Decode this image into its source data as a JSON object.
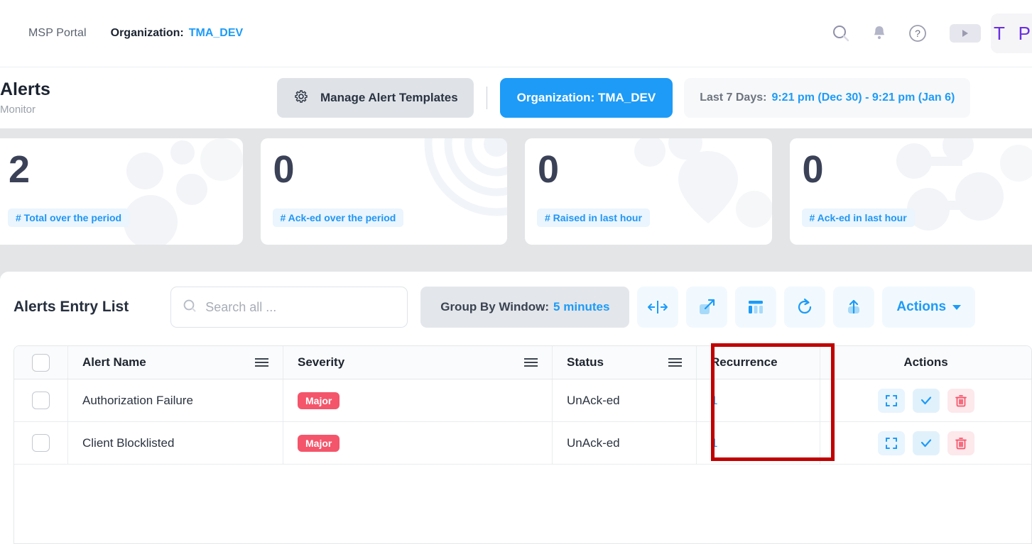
{
  "topbar": {
    "app_name": "MSP Portal",
    "org_label": "Organization:",
    "org_value": "TMA_DEV",
    "icons": [
      "search-icon",
      "bell-icon",
      "help-icon",
      "video-icon"
    ],
    "avatar_initials": "T P"
  },
  "subheader": {
    "title": "Alerts",
    "subtitle": "Monitor",
    "manage_templates": "Manage Alert Templates",
    "organization_button": "Organization: TMA_DEV",
    "range_label": "Last 7 Days:",
    "range_value": "9:21 pm (Dec 30) - 9:21 pm (Jan 6)"
  },
  "cards": [
    {
      "value": "2",
      "label": "# Total over the period",
      "watermark": "circles"
    },
    {
      "value": "0",
      "label": "# Ack-ed over the period",
      "watermark": "arcs"
    },
    {
      "value": "0",
      "label": "# Raised in last hour",
      "watermark": "pin"
    },
    {
      "value": "0",
      "label": "# Ack-ed in last hour",
      "watermark": "molecule"
    }
  ],
  "toolbar": {
    "panel_title": "Alerts Entry List",
    "search_placeholder": "Search all ...",
    "group_label": "Group By Window:",
    "group_value": "5 minutes",
    "icon_buttons": [
      "fit-columns-icon",
      "expand-icon",
      "columns-icon",
      "refresh-icon",
      "export-icon"
    ],
    "actions_label": "Actions"
  },
  "table": {
    "columns": [
      "Alert Name",
      "Severity",
      "Status",
      "Recurrence",
      "Actions"
    ],
    "rows": [
      {
        "name": "Authorization Failure",
        "severity": "Major",
        "status": "UnAck-ed",
        "recurrence": "1"
      },
      {
        "name": "Client Blocklisted",
        "severity": "Major",
        "status": "UnAck-ed",
        "recurrence": "1"
      }
    ]
  },
  "colors": {
    "accent_blue": "#1d9bf7",
    "severity_major": "#f4556a",
    "highlight_box": "#c00000",
    "page_background": "#e3e5e7"
  }
}
